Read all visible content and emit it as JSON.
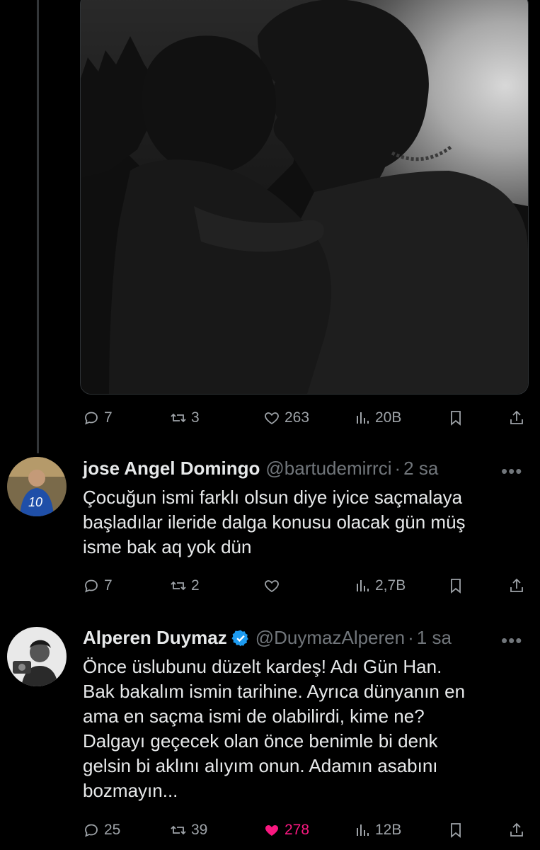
{
  "main_tweet": {
    "stats": {
      "replies": "7",
      "reposts": "3",
      "likes": "263",
      "views": "20B"
    }
  },
  "replies": [
    {
      "name": "jose Angel Domingo",
      "handle": "@bartudemirrci",
      "dot": "·",
      "time": "2 sa",
      "more": "•••",
      "text": "Çocuğun ismi farklı olsun diye iyice saçmalaya\nbaşladılar ileride dalga konusu olacak gün müş\nisme bak aq yok dün",
      "stats": {
        "replies": "7",
        "reposts": "2",
        "likes": "",
        "views": "2,7B"
      },
      "avatar_icon": "football-player-avatar",
      "jersey": "10"
    },
    {
      "name": "Alperen Duymaz",
      "handle": "@DuymazAlperen",
      "dot": "·",
      "time": "1 sa",
      "more": "•••",
      "text": "Önce üslubunu düzelt kardeş! Adı Gün Han.\nBak bakalım ismin tarihine. Ayrıca dünyanın en\nama en saçma ismi de olabilirdi, kime ne?\nDalgayı geçecek olan önce benimle bi denk\ngelsin bi aklını alıyım onun. Adamın asabını\nbozmayın...",
      "verified": true,
      "stats": {
        "replies": "25",
        "reposts": "39",
        "likes": "278",
        "views": "12B"
      },
      "liked": true,
      "avatar_icon": "bearded-man-avatar"
    }
  ],
  "colors": {
    "background": "#000000",
    "text": "#e7e9ea",
    "muted": "#71767b",
    "like": "#f91880",
    "verified": "#1d9bf0"
  }
}
